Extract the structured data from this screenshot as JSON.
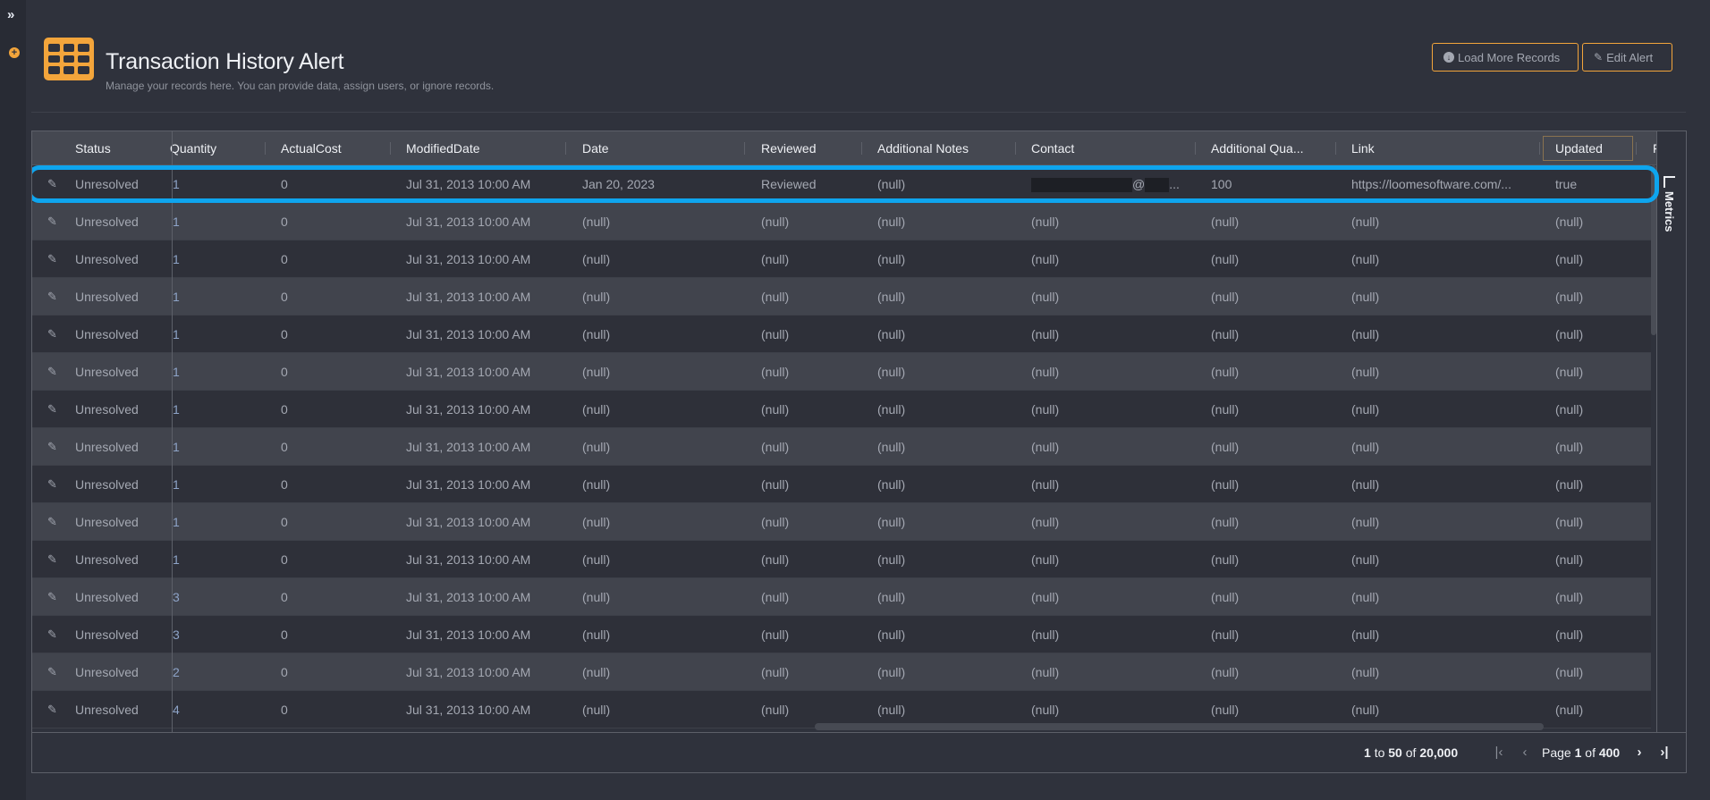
{
  "sidebar": {
    "expand_icon": "double-chevron-right-icon",
    "add_icon": "plus-circle-icon"
  },
  "header": {
    "icon": "table-grid-icon",
    "title": "Transaction History Alert",
    "subtitle": "Manage your records here. You can provide data, assign users, or ignore records.",
    "buttons": {
      "load_more": "Load More Records",
      "edit_alert": "Edit Alert"
    }
  },
  "grid": {
    "columns": [
      "Status",
      "Quantity",
      "ActualCost",
      "ModifiedDate",
      "Date",
      "Reviewed",
      "Additional Notes",
      "Contact",
      "Additional Qua...",
      "Link",
      "Updated",
      "F"
    ],
    "rows": [
      {
        "status": "Unresolved",
        "quantity": "1",
        "actual_cost": "0",
        "modified_date": "Jul 31, 2013 10:00 AM",
        "date": "Jan 20, 2023",
        "reviewed": "Reviewed",
        "notes": "(null)",
        "contact": "@",
        "contact_redacted": true,
        "additional_qty": "100",
        "link": "https://loomesoftware.com/...",
        "updated": "true"
      },
      {
        "status": "Unresolved",
        "quantity": "1",
        "actual_cost": "0",
        "modified_date": "Jul 31, 2013 10:00 AM",
        "date": "(null)",
        "reviewed": "(null)",
        "notes": "(null)",
        "contact": "(null)",
        "additional_qty": "(null)",
        "link": "(null)",
        "updated": "(null)"
      },
      {
        "status": "Unresolved",
        "quantity": "1",
        "actual_cost": "0",
        "modified_date": "Jul 31, 2013 10:00 AM",
        "date": "(null)",
        "reviewed": "(null)",
        "notes": "(null)",
        "contact": "(null)",
        "additional_qty": "(null)",
        "link": "(null)",
        "updated": "(null)"
      },
      {
        "status": "Unresolved",
        "quantity": "1",
        "actual_cost": "0",
        "modified_date": "Jul 31, 2013 10:00 AM",
        "date": "(null)",
        "reviewed": "(null)",
        "notes": "(null)",
        "contact": "(null)",
        "additional_qty": "(null)",
        "link": "(null)",
        "updated": "(null)"
      },
      {
        "status": "Unresolved",
        "quantity": "1",
        "actual_cost": "0",
        "modified_date": "Jul 31, 2013 10:00 AM",
        "date": "(null)",
        "reviewed": "(null)",
        "notes": "(null)",
        "contact": "(null)",
        "additional_qty": "(null)",
        "link": "(null)",
        "updated": "(null)"
      },
      {
        "status": "Unresolved",
        "quantity": "1",
        "actual_cost": "0",
        "modified_date": "Jul 31, 2013 10:00 AM",
        "date": "(null)",
        "reviewed": "(null)",
        "notes": "(null)",
        "contact": "(null)",
        "additional_qty": "(null)",
        "link": "(null)",
        "updated": "(null)"
      },
      {
        "status": "Unresolved",
        "quantity": "1",
        "actual_cost": "0",
        "modified_date": "Jul 31, 2013 10:00 AM",
        "date": "(null)",
        "reviewed": "(null)",
        "notes": "(null)",
        "contact": "(null)",
        "additional_qty": "(null)",
        "link": "(null)",
        "updated": "(null)"
      },
      {
        "status": "Unresolved",
        "quantity": "1",
        "actual_cost": "0",
        "modified_date": "Jul 31, 2013 10:00 AM",
        "date": "(null)",
        "reviewed": "(null)",
        "notes": "(null)",
        "contact": "(null)",
        "additional_qty": "(null)",
        "link": "(null)",
        "updated": "(null)"
      },
      {
        "status": "Unresolved",
        "quantity": "1",
        "actual_cost": "0",
        "modified_date": "Jul 31, 2013 10:00 AM",
        "date": "(null)",
        "reviewed": "(null)",
        "notes": "(null)",
        "contact": "(null)",
        "additional_qty": "(null)",
        "link": "(null)",
        "updated": "(null)"
      },
      {
        "status": "Unresolved",
        "quantity": "1",
        "actual_cost": "0",
        "modified_date": "Jul 31, 2013 10:00 AM",
        "date": "(null)",
        "reviewed": "(null)",
        "notes": "(null)",
        "contact": "(null)",
        "additional_qty": "(null)",
        "link": "(null)",
        "updated": "(null)"
      },
      {
        "status": "Unresolved",
        "quantity": "1",
        "actual_cost": "0",
        "modified_date": "Jul 31, 2013 10:00 AM",
        "date": "(null)",
        "reviewed": "(null)",
        "notes": "(null)",
        "contact": "(null)",
        "additional_qty": "(null)",
        "link": "(null)",
        "updated": "(null)"
      },
      {
        "status": "Unresolved",
        "quantity": "3",
        "actual_cost": "0",
        "modified_date": "Jul 31, 2013 10:00 AM",
        "date": "(null)",
        "reviewed": "(null)",
        "notes": "(null)",
        "contact": "(null)",
        "additional_qty": "(null)",
        "link": "(null)",
        "updated": "(null)"
      },
      {
        "status": "Unresolved",
        "quantity": "3",
        "actual_cost": "0",
        "modified_date": "Jul 31, 2013 10:00 AM",
        "date": "(null)",
        "reviewed": "(null)",
        "notes": "(null)",
        "contact": "(null)",
        "additional_qty": "(null)",
        "link": "(null)",
        "updated": "(null)"
      },
      {
        "status": "Unresolved",
        "quantity": "2",
        "actual_cost": "0",
        "modified_date": "Jul 31, 2013 10:00 AM",
        "date": "(null)",
        "reviewed": "(null)",
        "notes": "(null)",
        "contact": "(null)",
        "additional_qty": "(null)",
        "link": "(null)",
        "updated": "(null)"
      },
      {
        "status": "Unresolved",
        "quantity": "4",
        "actual_cost": "0",
        "modified_date": "Jul 31, 2013 10:00 AM",
        "date": "(null)",
        "reviewed": "(null)",
        "notes": "(null)",
        "contact": "(null)",
        "additional_qty": "(null)",
        "link": "(null)",
        "updated": "(null)"
      }
    ]
  },
  "side_panel": {
    "metrics_label": "Metrics",
    "metrics_icon": "line-chart-icon"
  },
  "pagination": {
    "from": "1",
    "to_word": "to",
    "to": "50",
    "of_word": "of",
    "total": "20,000",
    "page_word": "Page",
    "current_page": "1",
    "total_pages": "400"
  },
  "colors": {
    "accent": "#f3a53b",
    "highlight": "#0ea5ee",
    "background": "#2f323c"
  }
}
